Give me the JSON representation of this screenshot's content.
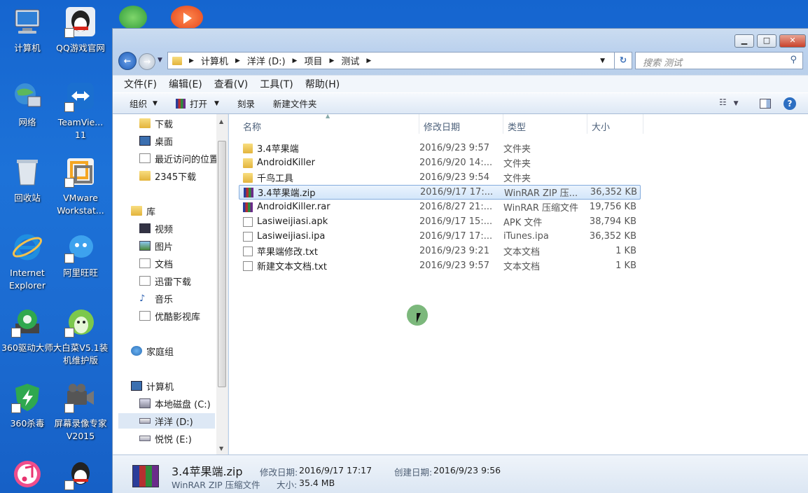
{
  "desktop": {
    "icons": [
      {
        "label": "计算机"
      },
      {
        "label": "QQ游戏官网"
      },
      {
        "label": "网络"
      },
      {
        "label": "TeamViewer 11",
        "display": "TeamVie... 11"
      },
      {
        "label": "回收站"
      },
      {
        "label": "VMware Workstat..."
      },
      {
        "label": "Internet Explorer"
      },
      {
        "label": "阿里旺旺"
      },
      {
        "label": "360驱动大师"
      },
      {
        "label": "大白菜V5.1装机维护版"
      },
      {
        "label": "360杀毒"
      },
      {
        "label": "屏幕录像专家V2015"
      }
    ]
  },
  "window": {
    "address": [
      "计算机",
      "洋洋 (D:)",
      "项目",
      "测试"
    ],
    "search_placeholder": "搜索 测试",
    "menu": [
      "文件(F)",
      "编辑(E)",
      "查看(V)",
      "工具(T)",
      "帮助(H)"
    ],
    "toolbar": {
      "organize": "组织",
      "open": "打开",
      "burn": "刻录",
      "new_folder": "新建文件夹"
    },
    "nav": {
      "favorites": [
        "下载",
        "桌面",
        "最近访问的位置",
        "2345下载"
      ],
      "library_label": "库",
      "library": [
        "视频",
        "图片",
        "文档",
        "迅雷下载",
        "音乐",
        "优酷影视库"
      ],
      "homegroup": "家庭组",
      "computer_label": "计算机",
      "drives": [
        "本地磁盘 (C:)",
        "洋洋 (D:)",
        "悦悦 (E:)"
      ]
    },
    "columns": {
      "name": "名称",
      "date": "修改日期",
      "type": "类型",
      "size": "大小"
    },
    "files": [
      {
        "name": "3.4苹果端",
        "date": "2016/9/23 9:57",
        "type": "文件夹",
        "size": "",
        "kind": "folder"
      },
      {
        "name": "AndroidKiller",
        "date": "2016/9/20 14:...",
        "type": "文件夹",
        "size": "",
        "kind": "folder"
      },
      {
        "name": "千鸟工具",
        "date": "2016/9/23 9:54",
        "type": "文件夹",
        "size": "",
        "kind": "folder"
      },
      {
        "name": "3.4苹果端.zip",
        "date": "2016/9/17 17:...",
        "type": "WinRAR ZIP 压...",
        "size": "36,352 KB",
        "kind": "rar",
        "selected": true
      },
      {
        "name": "AndroidKiller.rar",
        "date": "2016/8/27 21:...",
        "type": "WinRAR 压缩文件",
        "size": "19,756 KB",
        "kind": "rar"
      },
      {
        "name": "Lasiweijiasi.apk",
        "date": "2016/9/17 15:...",
        "type": "APK 文件",
        "size": "38,794 KB",
        "kind": "txt"
      },
      {
        "name": "Lasiweijiasi.ipa",
        "date": "2016/9/17 17:...",
        "type": "iTunes.ipa",
        "size": "36,352 KB",
        "kind": "txt"
      },
      {
        "name": "苹果端修改.txt",
        "date": "2016/9/23 9:21",
        "type": "文本文档",
        "size": "1 KB",
        "kind": "txt"
      },
      {
        "name": "新建文本文档.txt",
        "date": "2016/9/23 9:57",
        "type": "文本文档",
        "size": "1 KB",
        "kind": "txt"
      }
    ],
    "details": {
      "filename": "3.4苹果端.zip",
      "filetype": "WinRAR ZIP 压缩文件",
      "modified_label": "修改日期:",
      "modified": "2016/9/17 17:17",
      "created_label": "创建日期:",
      "created": "2016/9/23 9:56",
      "size_label": "大小:",
      "size": "35.4 MB"
    }
  }
}
